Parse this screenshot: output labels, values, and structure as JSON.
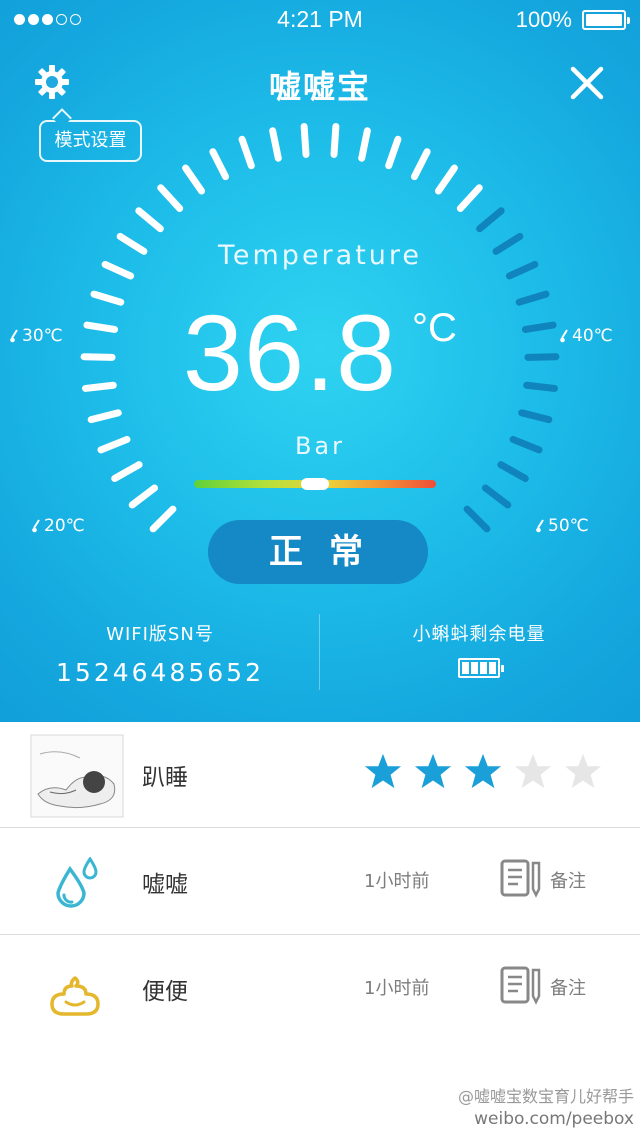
{
  "status_bar": {
    "time": "4:21 PM",
    "battery": "100%"
  },
  "header": {
    "title": "嘘嘘宝",
    "mode_tip": "模式设置"
  },
  "gauge": {
    "label": "Temperature",
    "value": "36.8",
    "unit": "°C",
    "bar_label": "Bar",
    "bar_position": 0.5,
    "scale": {
      "min": "20℃",
      "low": "30℃",
      "high": "40℃",
      "max": "50℃"
    },
    "state": "正常"
  },
  "device": {
    "sn_title": "WIFI版SN号",
    "sn": "15246485652",
    "battery_title": "小蝌蚪剩余电量"
  },
  "records": [
    {
      "label": "趴睡",
      "rating": 3,
      "rating_max": 5
    },
    {
      "label": "嘘嘘",
      "time": "1小时前",
      "note": "备注"
    },
    {
      "label": "便便",
      "time": "1小时前",
      "note": "备注"
    }
  ],
  "colors": {
    "accent": "#129fd9",
    "star_on": "#1a9fd8",
    "star_off": "#e6e6e6",
    "pee": "#3ab6d3",
    "poop": "#e4b72c"
  },
  "watermark": {
    "line1": "@嘘嘘宝数宝育儿好帮手",
    "line2": "weibo.com/peebox"
  }
}
